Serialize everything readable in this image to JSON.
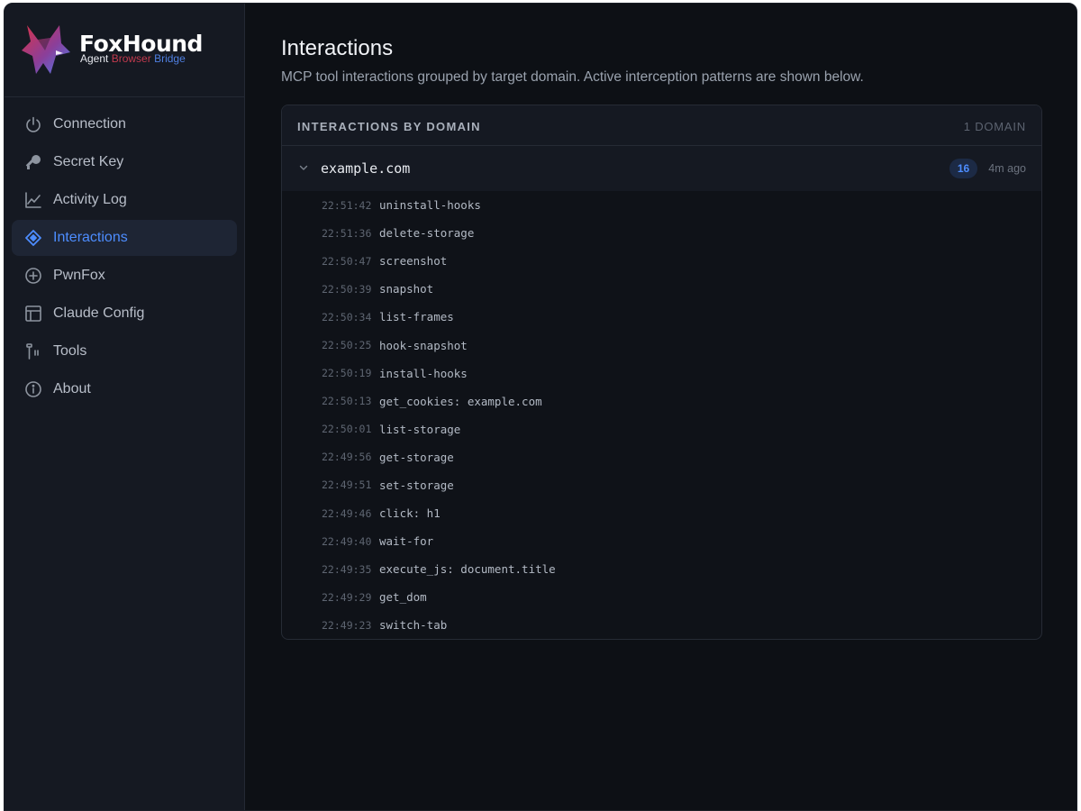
{
  "app": {
    "brand_title": "FoxHound",
    "brand_sub1": "Agent",
    "brand_sub2": "Browser",
    "brand_sub3": "Bridge"
  },
  "sidebar": {
    "items": [
      {
        "label": "Connection",
        "icon": "power-icon"
      },
      {
        "label": "Secret Key",
        "icon": "key-icon"
      },
      {
        "label": "Activity Log",
        "icon": "chart-line-icon"
      },
      {
        "label": "Interactions",
        "icon": "diamond-target-icon",
        "active": true
      },
      {
        "label": "PwnFox",
        "icon": "plus-circle-icon"
      },
      {
        "label": "Claude Config",
        "icon": "layout-icon"
      },
      {
        "label": "Tools",
        "icon": "tools-icon"
      },
      {
        "label": "About",
        "icon": "info-icon"
      }
    ]
  },
  "page": {
    "title": "Interactions",
    "description": "MCP tool interactions grouped by target domain. Active interception patterns are shown below."
  },
  "card": {
    "title": "INTERACTIONS BY DOMAIN",
    "count": "1 DOMAIN",
    "group": {
      "domain": "example.com",
      "badge": "16",
      "ago": "4m ago",
      "rows": [
        {
          "time": "22:51:42",
          "tool": "uninstall-hooks"
        },
        {
          "time": "22:51:36",
          "tool": "delete-storage"
        },
        {
          "time": "22:50:47",
          "tool": "screenshot"
        },
        {
          "time": "22:50:39",
          "tool": "snapshot"
        },
        {
          "time": "22:50:34",
          "tool": "list-frames"
        },
        {
          "time": "22:50:25",
          "tool": "hook-snapshot"
        },
        {
          "time": "22:50:19",
          "tool": "install-hooks"
        },
        {
          "time": "22:50:13",
          "tool": "get_cookies: example.com"
        },
        {
          "time": "22:50:01",
          "tool": "list-storage"
        },
        {
          "time": "22:49:56",
          "tool": "get-storage"
        },
        {
          "time": "22:49:51",
          "tool": "set-storage"
        },
        {
          "time": "22:49:46",
          "tool": "click: h1"
        },
        {
          "time": "22:49:40",
          "tool": "wait-for"
        },
        {
          "time": "22:49:35",
          "tool": "execute_js: document.title"
        },
        {
          "time": "22:49:29",
          "tool": "get_dom"
        },
        {
          "time": "22:49:23",
          "tool": "switch-tab"
        }
      ]
    }
  },
  "colors": {
    "accent": "#4d8dff",
    "background": "#0d1015",
    "sidebar": "#151922"
  }
}
